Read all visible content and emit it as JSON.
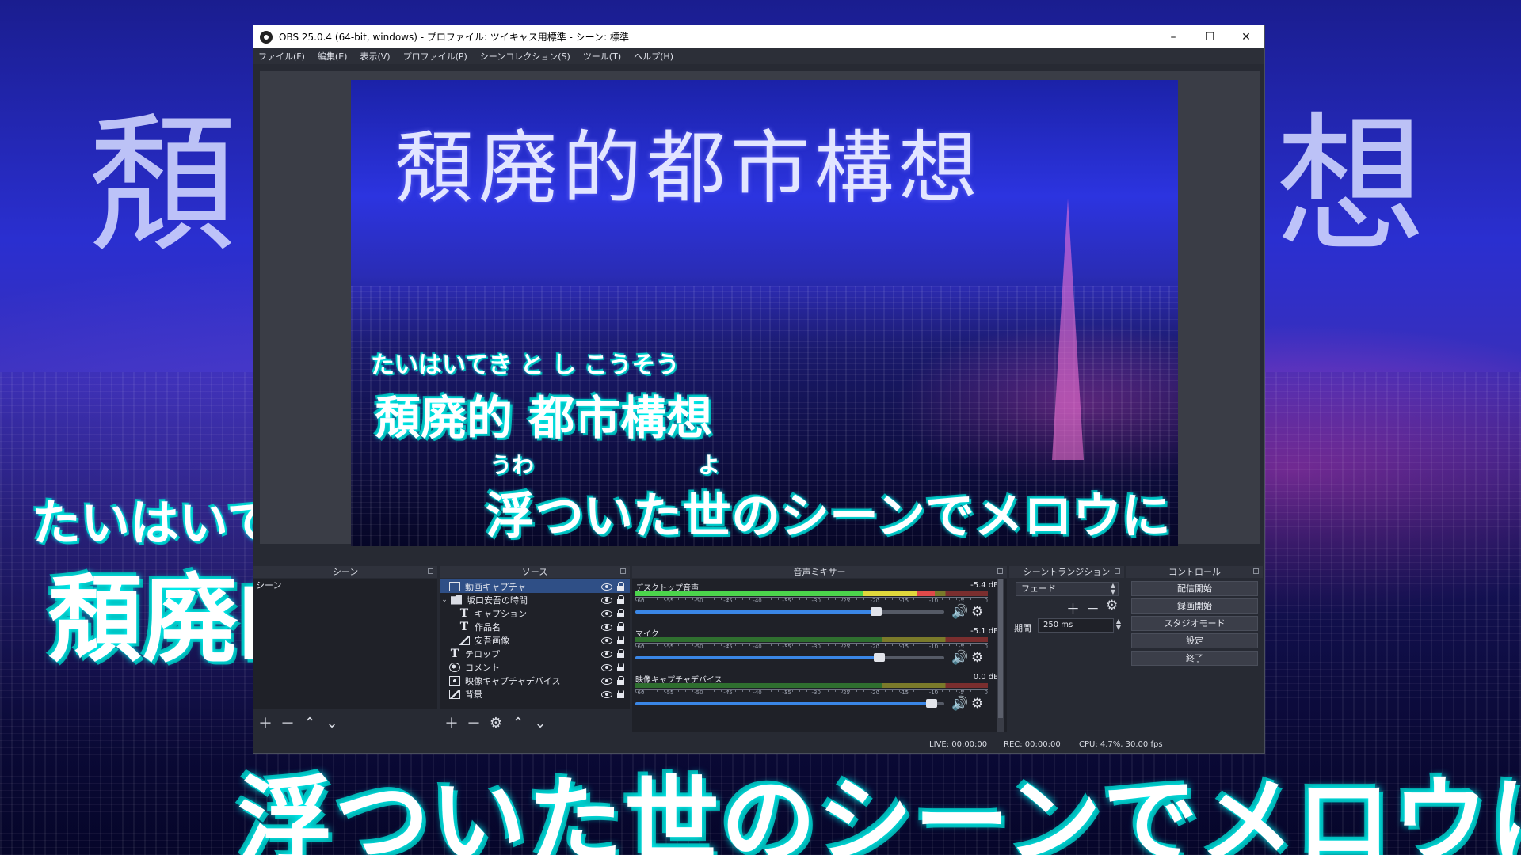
{
  "background": {
    "title_left": "頽",
    "title_right": "想",
    "furigana": "たいはいて",
    "kanji": "頽廃的",
    "lyric": "浮ついた世のシーンでメロウに"
  },
  "window": {
    "title": "OBS 25.0.4 (64-bit, windows) - プロファイル: ツイキャス用標準 - シーン: 標準",
    "buttons": {
      "minimize": "–",
      "maximize": "☐",
      "close": "✕"
    }
  },
  "menu": [
    "ファイル(F)",
    "編集(E)",
    "表示(V)",
    "プロファイル(P)",
    "シーンコレクション(S)",
    "ツール(T)",
    "ヘルプ(H)"
  ],
  "preview": {
    "title": "頽廃的都市構想",
    "furigana": "たいはいてき と し こうそう",
    "kanji": "頽廃的 都市構想",
    "ruby1": "うわ",
    "ruby2": "よ",
    "lyric": "浮ついた世のシーンでメロウに"
  },
  "docks": {
    "scenes": {
      "title": "シーン",
      "items": [
        "シーン"
      ]
    },
    "sources": {
      "title": "ソース",
      "items": [
        {
          "label": "動画キャプチャ",
          "icon": "monitor-icon",
          "selected": true
        },
        {
          "label": "坂口安吾の時間",
          "icon": "folder-icon",
          "group": true
        },
        {
          "label": "キャプション",
          "icon": "text-icon",
          "child": true
        },
        {
          "label": "作品名",
          "icon": "text-icon",
          "child": true
        },
        {
          "label": "安吾画像",
          "icon": "image-icon",
          "child": true
        },
        {
          "label": "テロップ",
          "icon": "text-icon"
        },
        {
          "label": "コメント",
          "icon": "globe-icon"
        },
        {
          "label": "映像キャプチャデバイス",
          "icon": "camera-icon"
        },
        {
          "label": "背景",
          "icon": "image-icon"
        }
      ]
    },
    "mixer": {
      "title": "音声ミキサー",
      "channels": [
        {
          "name": "デスクトップ音声",
          "db": "-5.4 dB",
          "level": 0.85,
          "volume": 0.78
        },
        {
          "name": "マイク",
          "db": "-5.1 dB",
          "level": 0.0,
          "volume": 0.79
        },
        {
          "name": "映像キャプチャデバイス",
          "db": "0.0 dB",
          "level": 0.0,
          "volume": 0.96
        }
      ],
      "scale": [
        "-60",
        "-55",
        "-50",
        "-45",
        "-40",
        "-35",
        "-30",
        "-25",
        "-20",
        "-15",
        "-10",
        "-5",
        "0"
      ]
    },
    "transitions": {
      "title": "シーントランジション",
      "selected": "フェード",
      "duration_label": "期間",
      "duration_value": "250 ms"
    },
    "controls": {
      "title": "コントロール",
      "buttons": [
        "配信開始",
        "録画開始",
        "スタジオモード",
        "設定",
        "終了"
      ]
    }
  },
  "status": {
    "live": "LIVE: 00:00:00",
    "rec": "REC: 00:00:00",
    "cpu": "CPU: 4.7%, 30.00 fps"
  },
  "colors": {
    "accent_blue": "#3a86e6",
    "selection": "#2f4f86",
    "meter_green": "#4cd44c",
    "meter_yellow": "#e0d73c",
    "meter_red": "#e04a4a"
  }
}
